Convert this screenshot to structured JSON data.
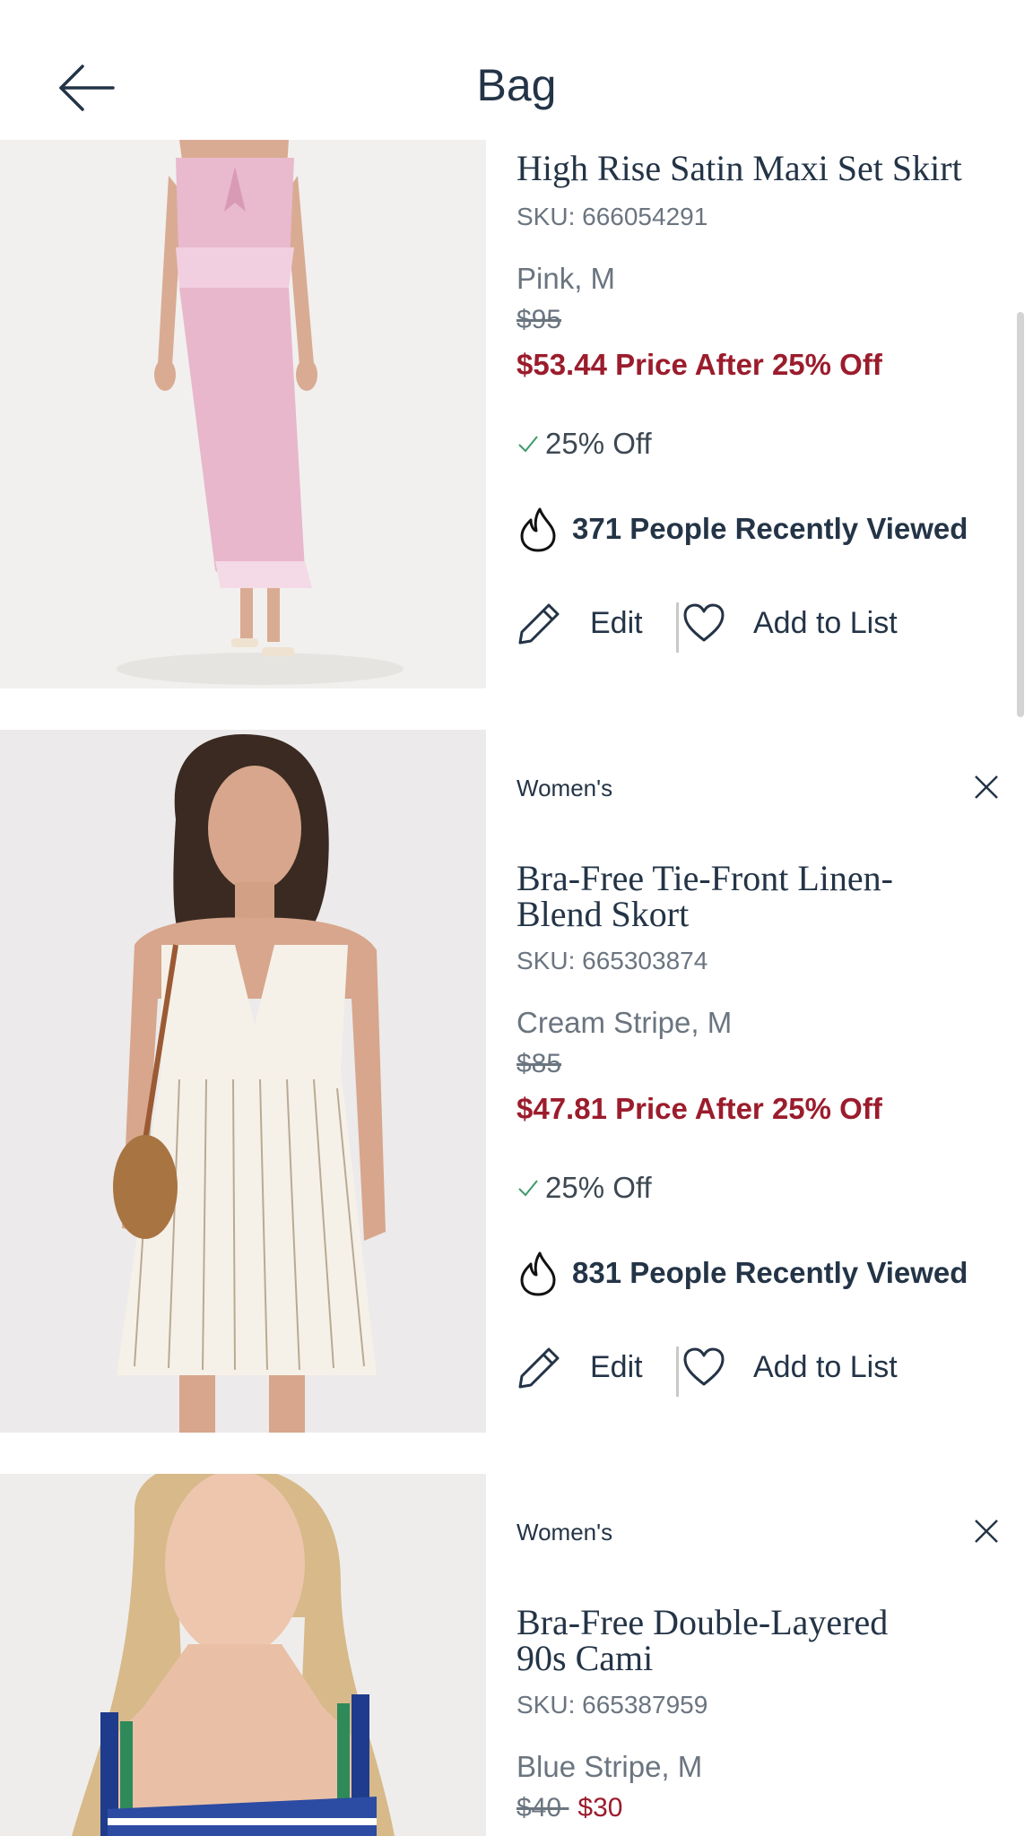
{
  "header": {
    "title": "Bag",
    "back_icon": "arrow-left-icon"
  },
  "colors": {
    "text": "#243447",
    "muted": "#6b7580",
    "sale": "#9b1c2c",
    "check": "#3c9a6a"
  },
  "items": [
    {
      "name": "High Rise Satin Maxi Set Skirt",
      "sku": "SKU: 666054291",
      "variant": "Pink, M",
      "original_price": "$95",
      "sale_price": "$53.44 Price After 25% Off",
      "promo": "25% Off",
      "viewed": "371 People Recently Viewed",
      "edit_label": "Edit",
      "list_label": "Add to List"
    },
    {
      "category": "Women's",
      "name": "Bra-Free Tie-Front Linen-Blend Skort",
      "sku": "SKU: 665303874",
      "variant": "Cream Stripe, M",
      "original_price": "$85",
      "sale_price": "$47.81 Price After 25% Off",
      "promo": "25% Off",
      "viewed": "831 People Recently Viewed",
      "edit_label": "Edit",
      "list_label": "Add to List"
    },
    {
      "category": "Women's",
      "name": "Bra-Free Double-Layered 90s Cami",
      "sku": "SKU: 665387959",
      "variant": "Blue Stripe, M",
      "original_price": "$40",
      "sale_price": "$30"
    }
  ]
}
